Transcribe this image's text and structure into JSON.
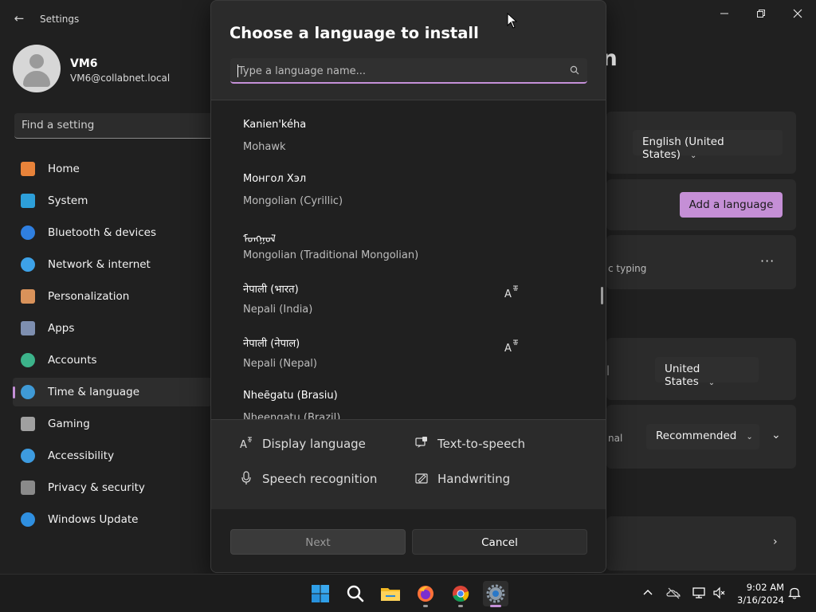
{
  "window": {
    "app_title": "Settings",
    "back_glyph": "←",
    "controls": [
      "minimize",
      "maximize",
      "close"
    ]
  },
  "profile": {
    "name": "VM6",
    "email": "VM6@collabnet.local"
  },
  "sidebar": {
    "search_placeholder": "Find a setting",
    "items": [
      {
        "label": "Home",
        "icon": "home-icon",
        "color": "#e8833a"
      },
      {
        "label": "System",
        "icon": "system-icon",
        "color": "#2d9fd9"
      },
      {
        "label": "Bluetooth & devices",
        "icon": "bluetooth-icon",
        "color": "#2f7fe0"
      },
      {
        "label": "Network & internet",
        "icon": "wifi-icon",
        "color": "#3da2e8"
      },
      {
        "label": "Personalization",
        "icon": "brush-icon",
        "color": "#d9925a"
      },
      {
        "label": "Apps",
        "icon": "apps-icon",
        "color": "#7e8fb0"
      },
      {
        "label": "Accounts",
        "icon": "accounts-icon",
        "color": "#3cb38a"
      },
      {
        "label": "Time & language",
        "icon": "globe-clock-icon",
        "color": "#3f9ad6",
        "active": true
      },
      {
        "label": "Gaming",
        "icon": "gamepad-icon",
        "color": "#a0a0a0"
      },
      {
        "label": "Accessibility",
        "icon": "accessibility-icon",
        "color": "#3d9be0"
      },
      {
        "label": "Privacy & security",
        "icon": "shield-icon",
        "color": "#8a8a8a"
      },
      {
        "label": "Windows Update",
        "icon": "update-icon",
        "color": "#2f8fe0"
      }
    ]
  },
  "background_page": {
    "title_fragment": "egion",
    "windows_display_language": "English (United States)",
    "add_language_label": "Add a language",
    "typing_fragment": "c typing",
    "country": "United States",
    "regional_format_fragment": "nal",
    "regional_format": "Recommended"
  },
  "dialog": {
    "title": "Choose a language to install",
    "search_placeholder": "Type a language name...",
    "languages": [
      {
        "native": "Kanien'kéha",
        "english": "Mohawk",
        "display": false
      },
      {
        "native": "Монгол Хэл",
        "english": "Mongolian (Cyrillic)",
        "display": false
      },
      {
        "native": "ᠮᠣᠩᠭᠣᠯ",
        "english": "Mongolian (Traditional Mongolian)",
        "display": false
      },
      {
        "native": "नेपाली (भारत)",
        "english": "Nepali (India)",
        "display": true
      },
      {
        "native": "नेपाली (नेपाल)",
        "english": "Nepali (Nepal)",
        "display": true
      },
      {
        "native": "Nheẽgatu (Brasiu)",
        "english": "Nheengatu (Brazil)",
        "display": false
      }
    ],
    "legend": {
      "display_language": "Display language",
      "text_to_speech": "Text-to-speech",
      "speech_recognition": "Speech recognition",
      "handwriting": "Handwriting"
    },
    "next_label": "Next",
    "cancel_label": "Cancel"
  },
  "taskbar": {
    "apps": [
      "windows-start-icon",
      "search-icon",
      "file-explorer-icon",
      "firefox-icon",
      "chrome-icon",
      "settings-icon"
    ],
    "time": "9:02 AM",
    "date": "3/16/2024"
  },
  "colors": {
    "accent": "#c590d8",
    "window_bg": "#202020",
    "card_bg": "#2b2b2b"
  }
}
